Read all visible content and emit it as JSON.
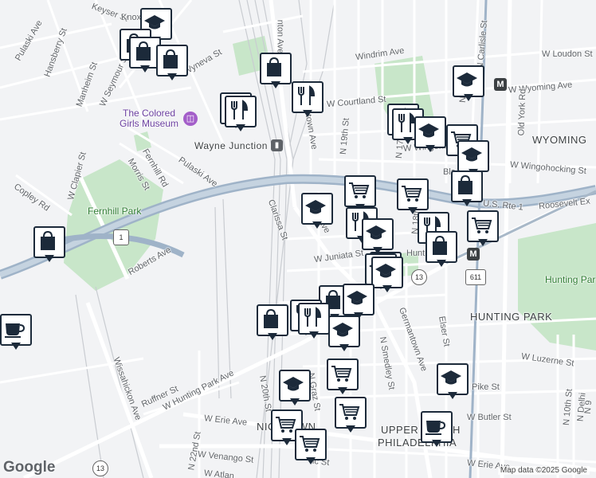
{
  "labels": {
    "keyser": "Keyser St",
    "knox": "Knox",
    "pulaski_ave_nw": "Pulaski Ave",
    "hansberry": "Hansberry St",
    "manheim": "Manheim St",
    "seymour": "W Seymour St",
    "wyneva": "Wyneva St",
    "germantown_top": "nton Ave",
    "colored_girls": "The Colored\nGirls Museum",
    "wayne_junction": "Wayne Junction",
    "pulaski_ave": "Pulaski Ave",
    "clapier": "W Clapier St",
    "fernhill_rd": "Fernhill Rd",
    "morris": "Morris St",
    "copley": "Copley Rd",
    "fernhill_park": "Fernhill Park",
    "roberts": "Roberts Ave",
    "clarissa": "Clarissa St",
    "wayne_ave": "Wayne Ave",
    "germantown_ave_mid": "Germantown Ave",
    "windrim": "Windrim Ave",
    "courtland": "W Courtland St",
    "n19th": "N 19th St",
    "n17th": "N 17th St",
    "n16th": "N 16th St",
    "wingohocking_top": "W Wingohocking",
    "wyoming_ave": "W Wyoming Ave",
    "wyoming": "WYOMING",
    "loudon": "W Loudon St",
    "carlisle": "N Carlisle St",
    "old_york": "Old York Rd",
    "wingohocking": "W Wingohocking St",
    "bla": "Bla",
    "us1": "U.S. Rte 1",
    "roosevelt": "Roosevelt Ex",
    "juniata": "W Juniata St",
    "hunting_park_sta": "Hunting Park",
    "hunting_park": "HUNTING PARK",
    "hunting_park_park": "Hunting Par",
    "germantown_lower": "Germantown Ave",
    "smedley": "N Smedley St",
    "elser": "Elser St",
    "luzerne": "W Luzerne St",
    "pike": "Pike St",
    "butler": "W Butler St",
    "w_hunting_park": "W Hunting Park Ave",
    "ruffner": "Ruffner St",
    "wissahickon": "Wissahickon Ave",
    "n20th": "N 20th St",
    "graz": "N Graz St",
    "n22nd": "N 22nd St",
    "erie": "W Erie Ave",
    "erie_e": "W Erie Ave",
    "venango": "W Venango St",
    "atlantic": "W Atlan",
    "nicetown": "NICETOWN",
    "upper_north": "UPPER NORTH",
    "philadelphia": "PHILADELPHIA",
    "n10th": "N 10th St",
    "n_delhi": "N Delhi",
    "ru": "Ru",
    "n9th": "N 9",
    "n18th": "N 18th St",
    "ic": "ic St"
  },
  "routes": {
    "us1_shield": "1",
    "r13_a": "13",
    "r13_b": "13",
    "r611": "611"
  },
  "metro": {
    "glyph": "M"
  },
  "brand": {
    "google": "Google",
    "credit": "Map data ©2025 Google"
  },
  "colors": {
    "marker_border": "#1c2a3a",
    "park": "#c8e6c9",
    "highway": "#9fb3c8",
    "road": "#ffffff"
  }
}
